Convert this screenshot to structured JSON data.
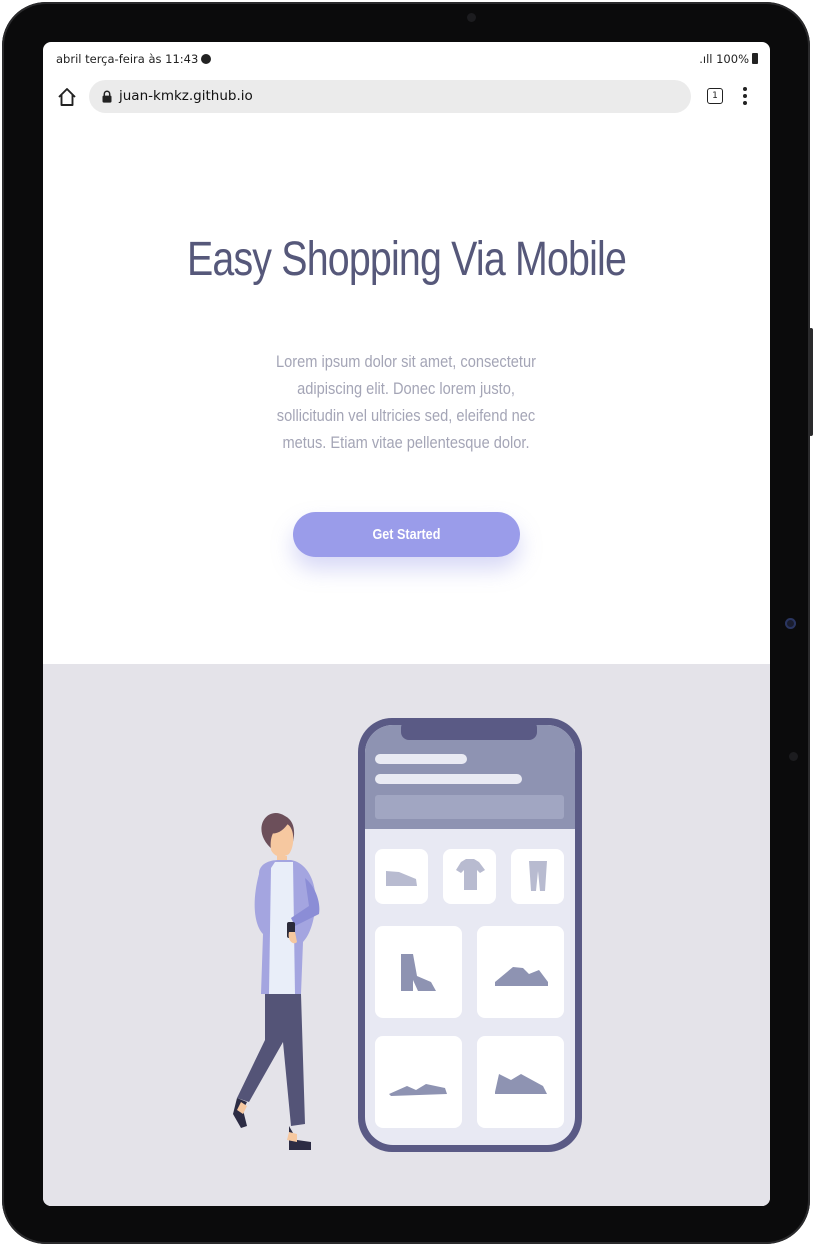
{
  "status_bar": {
    "time_text": "abril terça-feira às 11:43",
    "right_text": ".ıll 100%"
  },
  "browser": {
    "url": "juan-kmkz.github.io",
    "tab_count": "1"
  },
  "hero": {
    "title": "Easy Shopping Via Mobile",
    "description": "Lorem ipsum dolor sit amet, consectetur adipiscing elit. Donec lorem justo, sollicitudin vel ultricies sed, eleifend nec metus. Etiam vitae pellentesque dolor.",
    "cta_label": "Get Started"
  },
  "colors": {
    "title": "#56587a",
    "description": "#a4a5b6",
    "cta": "#9a9cea",
    "illustration_bg": "#e4e3e9",
    "phone_frame": "#5a5a85"
  },
  "icons": [
    "home-icon",
    "lock-icon",
    "tabs-icon",
    "more-menu-icon",
    "spotify-icon",
    "battery-icon"
  ]
}
